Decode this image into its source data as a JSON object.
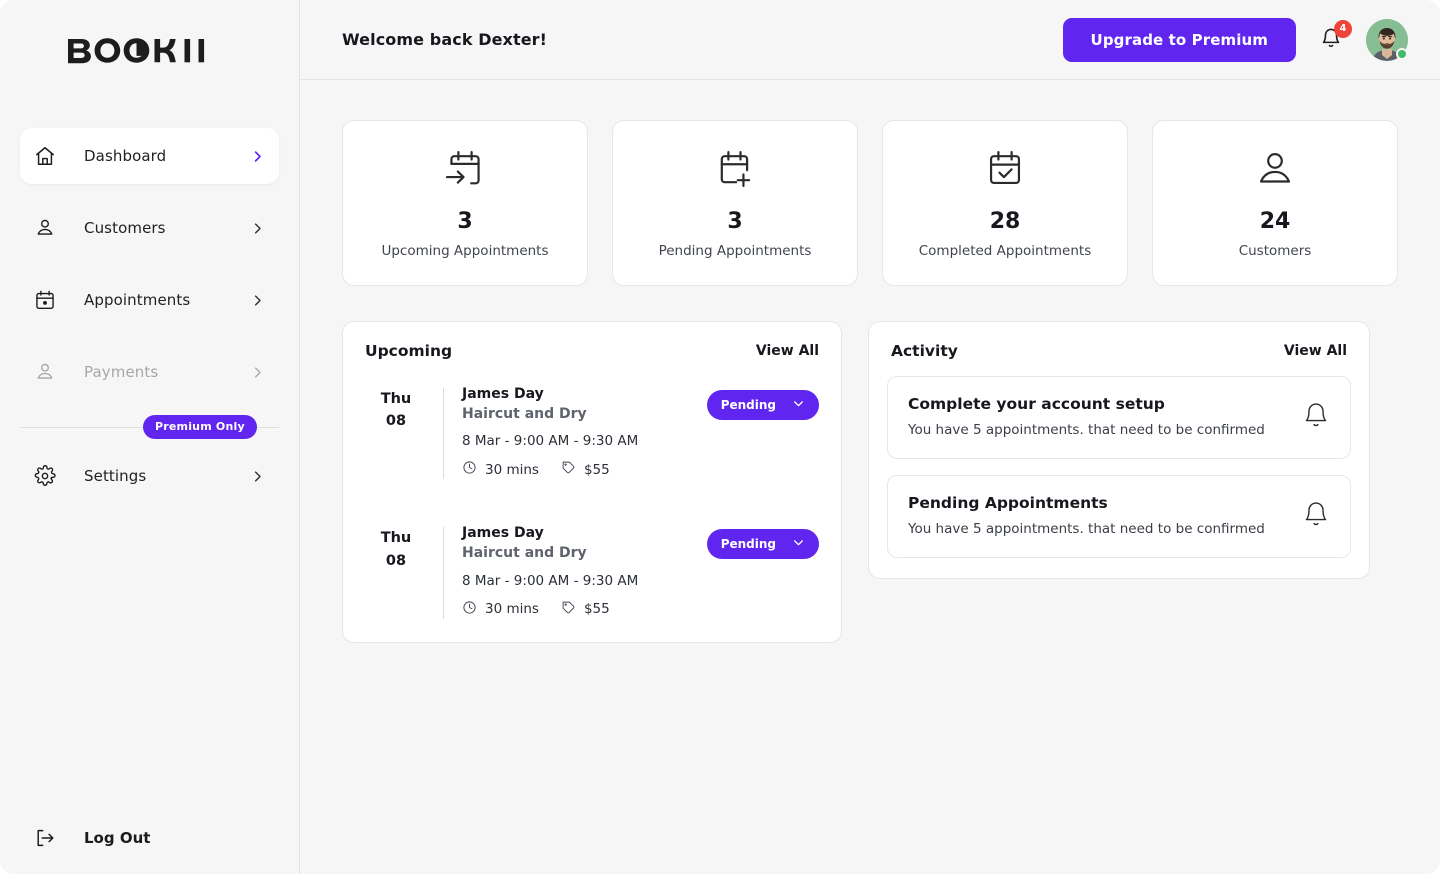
{
  "brand": {
    "name": "BOOKII"
  },
  "sidebar": {
    "items": [
      {
        "label": "Dashboard",
        "icon": "home-icon",
        "active": true,
        "disabled": false
      },
      {
        "label": "Customers",
        "icon": "user-icon",
        "active": false,
        "disabled": false
      },
      {
        "label": "Appointments",
        "icon": "calendar-icon",
        "active": false,
        "disabled": false
      },
      {
        "label": "Payments",
        "icon": "user-icon",
        "active": false,
        "disabled": true
      }
    ],
    "premium_badge": "Premium Only",
    "settings": {
      "label": "Settings",
      "icon": "gear-icon"
    },
    "logout": {
      "label": "Log Out",
      "icon": "logout-icon"
    }
  },
  "header": {
    "welcome": "Welcome back Dexter!",
    "upgrade_label": "Upgrade to Premium",
    "notification_count": "4"
  },
  "stats": [
    {
      "value": "3",
      "label": "Upcoming Appointments",
      "icon": "calendar-arrow-icon"
    },
    {
      "value": "3",
      "label": "Pending Appointments",
      "icon": "calendar-plus-icon"
    },
    {
      "value": "28",
      "label": "Completed Appointments",
      "icon": "calendar-check-icon"
    },
    {
      "value": "24",
      "label": "Customers",
      "icon": "user-icon"
    }
  ],
  "upcoming": {
    "title": "Upcoming",
    "view_all": "View All",
    "appointments": [
      {
        "day_of_week": "Thu",
        "day_of_month": "08",
        "customer": "James Day",
        "service": "Haircut and Dry",
        "when": "8 Mar - 9:00 AM - 9:30 AM",
        "duration": "30 mins",
        "price": "$55",
        "status": "Pending"
      },
      {
        "day_of_week": "Thu",
        "day_of_month": "08",
        "customer": "James Day",
        "service": "Haircut and Dry",
        "when": "8 Mar - 9:00 AM - 9:30 AM",
        "duration": "30 mins",
        "price": "$55",
        "status": "Pending"
      }
    ]
  },
  "activity": {
    "title": "Activity",
    "view_all": "View All",
    "items": [
      {
        "title": "Complete your account setup",
        "subtitle": "You have 5 appointments. that need to be confirmed",
        "icon": "bell-icon"
      },
      {
        "title": "Pending Appointments",
        "subtitle": "You have 5 appointments. that need to be confirmed",
        "icon": "bell-icon"
      }
    ]
  },
  "colors": {
    "accent": "#6026f0",
    "badge_red": "#f04438",
    "online_green": "#3fba6a",
    "page_bg": "#f6f6f6",
    "card_bg": "#ffffff",
    "text_primary": "#16181d",
    "text_muted": "#5e636e"
  }
}
